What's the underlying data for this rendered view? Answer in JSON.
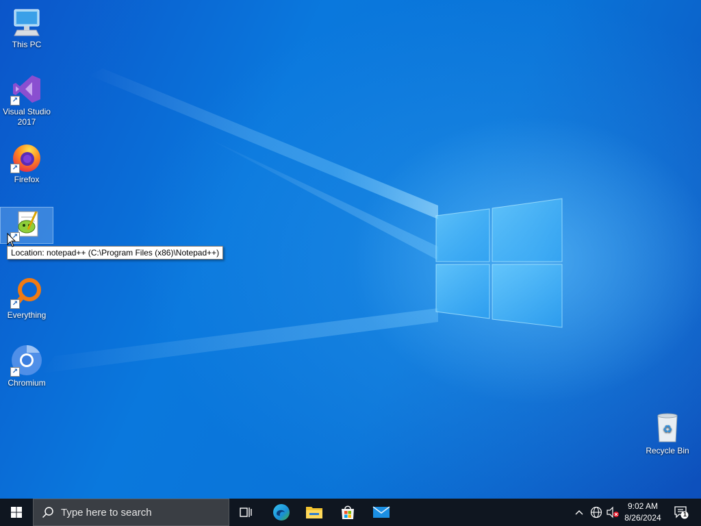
{
  "desktop": {
    "icons": [
      {
        "label": "This PC"
      },
      {
        "label": "Visual Studio\n2017"
      },
      {
        "label": "Firefox"
      },
      {
        "label": ""
      },
      {
        "label": "Everything"
      },
      {
        "label": "Chromium"
      },
      {
        "label": "Recycle Bin"
      }
    ],
    "tooltip": "Location: notepad++ (C:\\Program Files (x86)\\Notepad++)"
  },
  "taskbar": {
    "search_placeholder": "Type here to search",
    "pinned": [
      "task-view",
      "edge",
      "file-explorer",
      "microsoft-store",
      "mail"
    ],
    "clock_time": "9:02 AM",
    "clock_date": "8/26/2024",
    "notification_count": "1"
  },
  "colors": {
    "taskbar_bg": "#0f1620",
    "desktop_blue": "#0a78dd",
    "accent": "#0078d7"
  }
}
